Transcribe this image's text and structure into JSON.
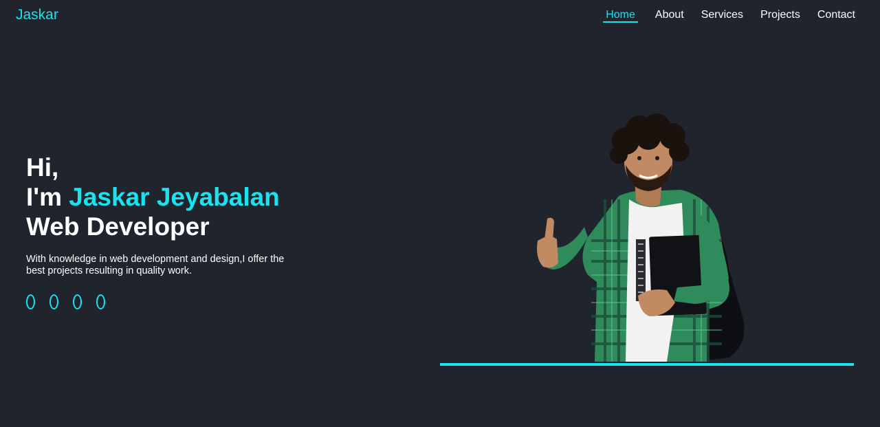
{
  "header": {
    "logo": "Jaskar",
    "nav": [
      {
        "label": "Home",
        "active": true
      },
      {
        "label": "About",
        "active": false
      },
      {
        "label": "Services",
        "active": false
      },
      {
        "label": "Projects",
        "active": false
      },
      {
        "label": "Contact",
        "active": false
      }
    ]
  },
  "hero": {
    "line1": "Hi,",
    "line2_prefix": "I'm ",
    "name": "Jaskar Jeyabalan",
    "role": "Web Developer",
    "description": "With knowledge in web development and design,I offer the best projects resulting in quality work.",
    "social_icons": [
      "social-icon-1",
      "social-icon-2",
      "social-icon-3",
      "social-icon-4"
    ]
  },
  "colors": {
    "background": "#1f242d",
    "accent": "#19e3ef",
    "text": "#ffffff"
  }
}
